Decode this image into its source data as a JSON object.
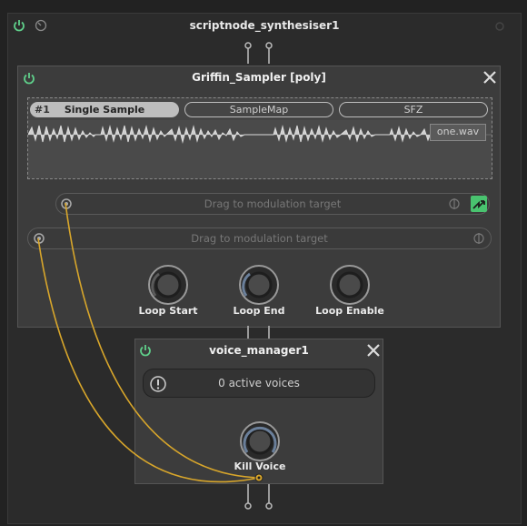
{
  "root": {
    "title": "scriptnode_synthesiser1"
  },
  "sampler": {
    "title": "Griffin_Sampler [poly]",
    "tabs": [
      {
        "index": "#1",
        "label": "Single Sample",
        "selected": true
      },
      {
        "label": "SampleMap",
        "selected": false
      },
      {
        "label": "SFZ",
        "selected": false
      }
    ],
    "file": "one.wav",
    "mod_slots": [
      {
        "label": "Drag to modulation target"
      },
      {
        "label": "Drag to modulation target"
      }
    ],
    "knobs": [
      {
        "label": "Loop Start"
      },
      {
        "label": "Loop End"
      },
      {
        "label": "Loop Enable"
      }
    ]
  },
  "voice_manager": {
    "title": "voice_manager1",
    "active_voices": "0 active voices",
    "knob": {
      "label": "Kill Voice"
    }
  },
  "colors": {
    "power": "#5fcf8a",
    "cable": "#d8a62b",
    "accent": "#49c36f"
  }
}
